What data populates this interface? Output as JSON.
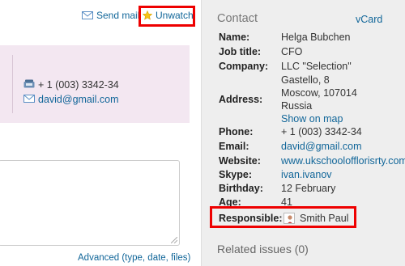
{
  "actions": {
    "send_mail": "Send mail",
    "unwatch": "Unwatch"
  },
  "card": {
    "phone": "+ 1 (003) 3342-34",
    "email": "david@gmail.com"
  },
  "comment": {
    "advanced_link": "Advanced (type, date, files)"
  },
  "sidebar": {
    "title": "Contact",
    "vcard": "vCard",
    "fields": {
      "name_label": "Name:",
      "name": "Helga Bubchen",
      "job_label": "Job title:",
      "job": "CFO",
      "company_label": "Company:",
      "company": "LLC \"Selection\"",
      "address_label": "Address:",
      "address_line1": "Gastello, 8",
      "address_line2": "Moscow, 107014",
      "address_line3": "Russia",
      "show_on_map": "Show on map",
      "phone_label": "Phone:",
      "phone": "+ 1 (003) 3342-34",
      "email_label": "Email:",
      "email": "david@gmail.com",
      "website_label": "Website:",
      "website": "www.ukschoolofflorisrty.com",
      "skype_label": "Skype:",
      "skype": "ivan.ivanov",
      "birthday_label": "Birthday:",
      "birthday": "12 February",
      "age_label": "Age:",
      "age": "41",
      "responsible_label": "Responsible:",
      "responsible": "Smith Paul"
    },
    "related_issues": "Related issues (0)"
  },
  "colors": {
    "link": "#116699",
    "highlight": "#ee0000",
    "card_bg": "#f3e7f1",
    "sidebar_bg": "#eeeeee"
  },
  "icons": [
    "mail-icon",
    "star-icon",
    "phone-icon",
    "envelope-icon",
    "avatar-icon"
  ]
}
